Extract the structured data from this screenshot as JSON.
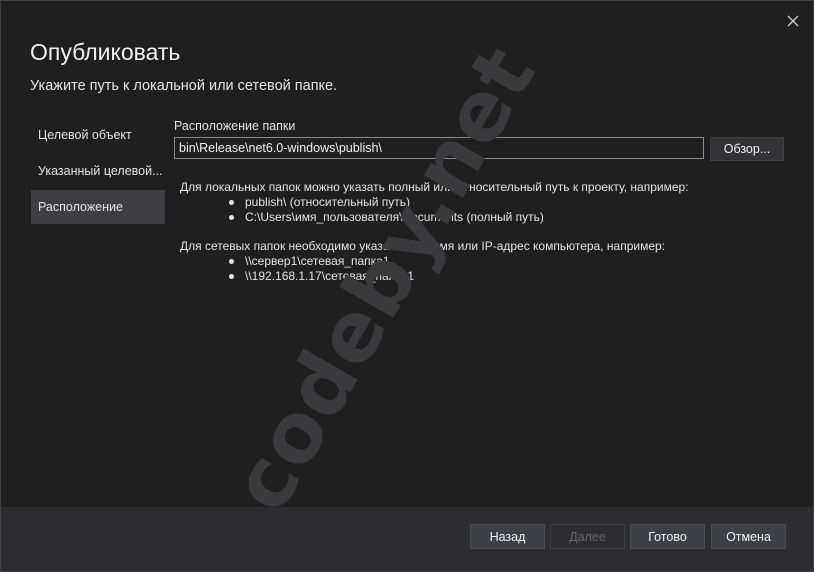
{
  "dialog": {
    "title": "Опубликовать",
    "subtitle": "Укажите путь к локальной или сетевой папке."
  },
  "nav": {
    "items": [
      {
        "label": "Целевой объект"
      },
      {
        "label": "Указанный целевой..."
      },
      {
        "label": "Расположение"
      }
    ],
    "active_index": 2
  },
  "location": {
    "label": "Расположение папки",
    "path_value": "bin\\Release\\net6.0-windows\\publish\\",
    "browse_label": "Обзор..."
  },
  "help": {
    "local_intro": "Для локальных папок можно указать полный или относительный путь к проекту, например:",
    "local_examples": [
      "publish\\ (относительный путь)",
      "C:\\Users\\имя_пользователя\\Documents (полный путь)"
    ],
    "network_intro": "Для сетевых папок необходимо указать \"\\\\\" и имя или IP-адрес компьютера, например:",
    "network_examples": [
      "\\\\сервер1\\сетевая_папка1",
      "\\\\192.168.1.17\\сетевая_папка1"
    ]
  },
  "watermark": "codeby.net",
  "footer": {
    "back_label": "Назад",
    "next_label": "Далее",
    "finish_label": "Готово",
    "cancel_label": "Отмена"
  },
  "colors": {
    "background": "#1f1f1f",
    "footer": "#2d2d30",
    "active_nav": "#3e3e42",
    "text": "#f1f1f1",
    "disabled_text": "#656565"
  },
  "icons": {
    "close": "close-icon"
  }
}
